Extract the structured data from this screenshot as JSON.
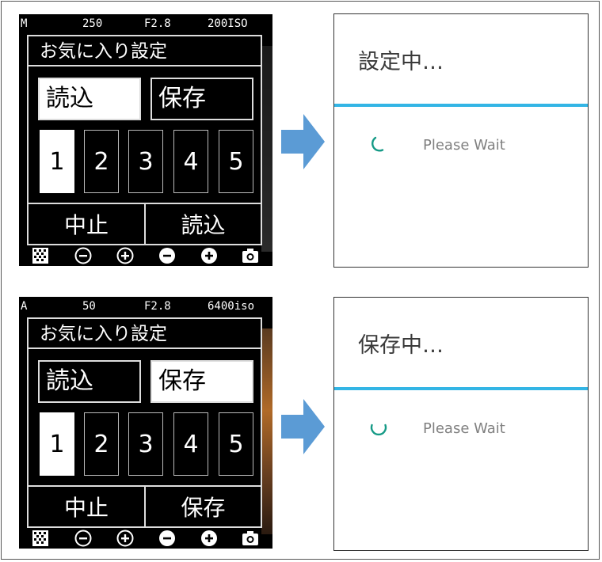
{
  "panels": [
    {
      "status": {
        "mode": "M",
        "shutter": "250",
        "aperture": "F2.8",
        "iso": "200ISO"
      },
      "dialog": {
        "title": "お気に入り設定",
        "load_label": "読込",
        "save_label": "保存",
        "selected_action": "load",
        "slots": [
          "1",
          "2",
          "3",
          "4",
          "5"
        ],
        "selected_slot": "1",
        "cancel_label": "中止",
        "confirm_label": "読込"
      },
      "progress": {
        "title": "設定中…",
        "message": "Please Wait"
      }
    },
    {
      "status": {
        "mode": "A",
        "shutter": "50",
        "aperture": "F2.8",
        "iso": "6400iso"
      },
      "dialog": {
        "title": "お気に入り設定",
        "load_label": "読込",
        "save_label": "保存",
        "selected_action": "save",
        "slots": [
          "1",
          "2",
          "3",
          "4",
          "5"
        ],
        "selected_slot": "1",
        "cancel_label": "中止",
        "confirm_label": "保存"
      },
      "progress": {
        "title": "保存中…",
        "message": "Please Wait"
      }
    }
  ],
  "iconbar": [
    "grid-icon",
    "minus-circle-outline-icon",
    "plus-circle-outline-icon",
    "minus-circle-filled-icon",
    "plus-circle-filled-icon",
    "camera-icon"
  ],
  "colors": {
    "accent_line": "#33b5e5",
    "spinner": "#159a86",
    "arrow": "#5b9bd5"
  }
}
